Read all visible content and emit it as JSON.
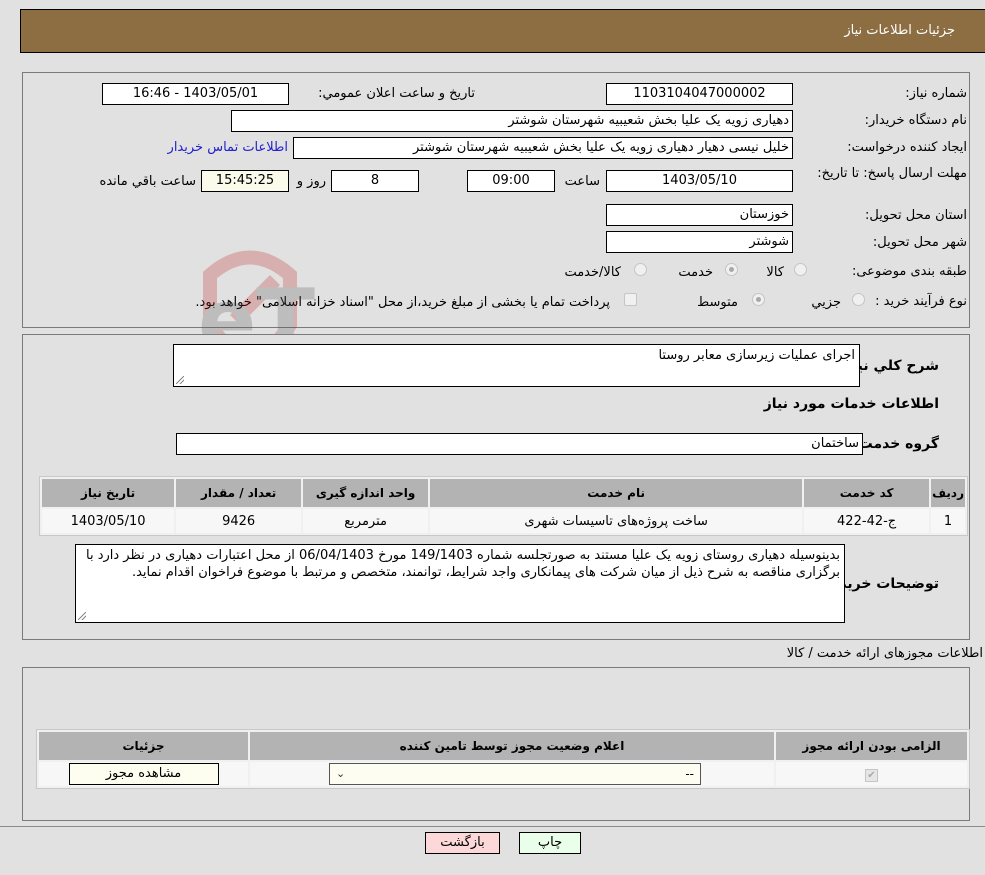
{
  "header": {
    "title": "جزئیات اطلاعات نیاز"
  },
  "fields": {
    "need_number": {
      "label": "شماره نیاز:",
      "value": "1103104047000002"
    },
    "announce_datetime": {
      "label": "تاریخ و ساعت اعلان عمومي:",
      "value": "1403/05/01 - 16:46"
    },
    "buyer_org": {
      "label": "نام دستگاه خریدار:",
      "value": "دهیاری زویه یک علیا بخش شعیبیه شهرستان شوشتر"
    },
    "requester": {
      "label": "ایجاد کننده درخواست:",
      "value": "خلیل نیسی دهیار دهیاری زویه یک علیا بخش شعیبیه شهرستان شوشتر"
    },
    "contact_link": "اطلاعات تماس خریدار",
    "deadline": {
      "label": "مهلت ارسال پاسخ: تا تاریخ:",
      "date": "1403/05/10",
      "time_label": "ساعت",
      "time": "09:00",
      "days": "8",
      "days_label": "روز و",
      "remaining": "15:45:25",
      "remaining_label": "ساعت باقي مانده"
    },
    "province": {
      "label": "استان محل تحویل:",
      "value": "خوزستان"
    },
    "city": {
      "label": "شهر محل تحویل:",
      "value": "شوشتر"
    },
    "category": {
      "label": "طبقه بندی موضوعی:",
      "options": [
        "کالا",
        "خدمت",
        "کالا/خدمت"
      ],
      "selected": "خدمت"
    },
    "process": {
      "label": "نوع فرآیند خرید :",
      "options": [
        "جزيي",
        "متوسط"
      ],
      "selected": "متوسط",
      "treasury_note": "پرداخت تمام یا بخشی از مبلغ خرید،از محل \"اسناد خزانه اسلامی\" خواهد بود."
    }
  },
  "details": {
    "summary_label": "شرح كلي نياز:",
    "summary": "اجرای عملیات زیرسازی معابر روستا",
    "services_title": "اطلاعات خدمات مورد نياز",
    "service_group_label": "گروه خدمت:",
    "service_group": "ساختمان",
    "table": {
      "headers": [
        "رديف",
        "کد خدمت",
        "نام خدمت",
        "واحد اندازه گیری",
        "تعداد / مقدار",
        "تاريخ نياز"
      ],
      "rows": [
        [
          "1",
          "ج-42-422",
          "ساخت پروژه‌های تاسیسات شهری",
          "مترمربع",
          "9426",
          "1403/05/10"
        ]
      ]
    },
    "buyer_notes_label": "توضيحات خريدار:",
    "buyer_notes": "بدینوسیله دهیاری روستای زویه یک علیا مستند به صورتجلسه شماره 149/1403 مورخ 06/04/1403 از محل اعتبارات دهیاری در نظر دارد با برگزاری مناقصه به شرح ذیل از میان شرکت های پیمانکاری واجد شرایط، توانمند، متخصص و مرتبط با موضوع فراخوان اقدام نماید."
  },
  "permits": {
    "title": "اطلاعات مجوزهای ارائه خدمت / کالا",
    "headers": [
      "الزامی بودن ارائه مجوز",
      "اعلام وضعیت مجوز توسط تامین کننده",
      "جزئیات"
    ],
    "row": {
      "required_checked": true,
      "status_value": "--",
      "details_button": "مشاهده مجوز"
    }
  },
  "buttons": {
    "print": "چاپ",
    "back": "بازگشت"
  },
  "watermark": "AriaTender.neT"
}
